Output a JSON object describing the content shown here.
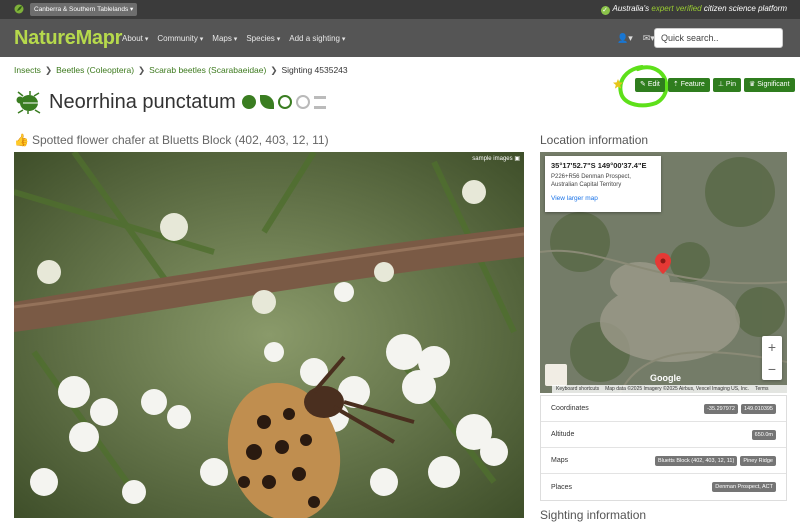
{
  "topbar": {
    "region_label": "Canberra & Southern Tablelands",
    "tagline_pre": "Australia's ",
    "tagline_highlight": "expert verified",
    "tagline_post": " citizen science platform"
  },
  "navbar": {
    "logo_part1": "Nature",
    "logo_part2": "Mapr",
    "items": [
      "About",
      "Community",
      "Maps",
      "Species",
      "Add a sighting"
    ],
    "search_placeholder": "Quick search.."
  },
  "breadcrumb": {
    "items": [
      "Insects",
      "Beetles (Coleoptera)",
      "Scarab beetles (Scarabaeidae)"
    ],
    "current": "Sighting 4535243"
  },
  "species": {
    "name": "Neorrhina punctatum"
  },
  "actions": {
    "edit": "Edit",
    "feature": "Feature",
    "pin": "Pin",
    "significant": "Significant"
  },
  "photo": {
    "heading": "Spotted flower chafer at Bluetts Block (402, 403, 12, 11)",
    "badge": "sample images"
  },
  "location": {
    "heading": "Location information",
    "map_coord": "35°17'52.7\"S 149°00'37.4\"E",
    "map_addr_line1": "P226+R56 Denman Prospect,",
    "map_addr_line2": "Australian Capital Territory",
    "map_link": "View larger map",
    "google": "Google",
    "attrib_shortcuts": "Keyboard shortcuts",
    "attrib_data": "Map data ©2025 Imagery ©2025 Airbus, Vexcel Imaging US, Inc.",
    "attrib_terms": "Terms",
    "zoom_in": "+",
    "zoom_out": "−"
  },
  "info": {
    "coordinates_label": "Coordinates",
    "lat": "-35.297972",
    "lon": "149.010395",
    "altitude_label": "Altitude",
    "altitude": "650.0m",
    "maps_label": "Maps",
    "map1": "Bluetts Block (402, 403, 12, 11)",
    "map2": "Piney Ridge",
    "places_label": "Places",
    "place1": "Denman Prospect, ACT"
  },
  "sighting_heading": "Sighting information"
}
